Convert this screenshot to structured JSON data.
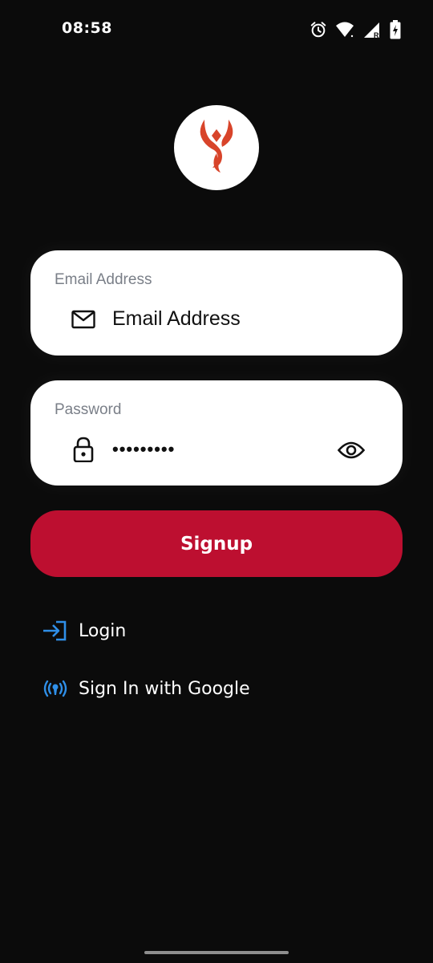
{
  "status_bar": {
    "time": "08:58",
    "icons": [
      "alarm-icon",
      "wifi-icon",
      "signal-icon",
      "battery-charging-icon"
    ]
  },
  "logo": {
    "icon": "horns-logo-icon",
    "color": "#d8442a"
  },
  "email_field": {
    "label": "Email Address",
    "placeholder": "Email Address",
    "icon": "mail-icon"
  },
  "password_field": {
    "label": "Password",
    "value": "•••••••••",
    "icon": "lock-icon",
    "toggle_icon": "eye-icon"
  },
  "signup_button": {
    "label": "Signup",
    "color": "#bd0f30"
  },
  "links": {
    "login": {
      "label": "Login",
      "icon": "login-arrow-icon",
      "color": "#2f8fe8"
    },
    "google": {
      "label": "Sign In with Google",
      "icon": "broadcast-icon",
      "color": "#2f8fe8"
    }
  }
}
